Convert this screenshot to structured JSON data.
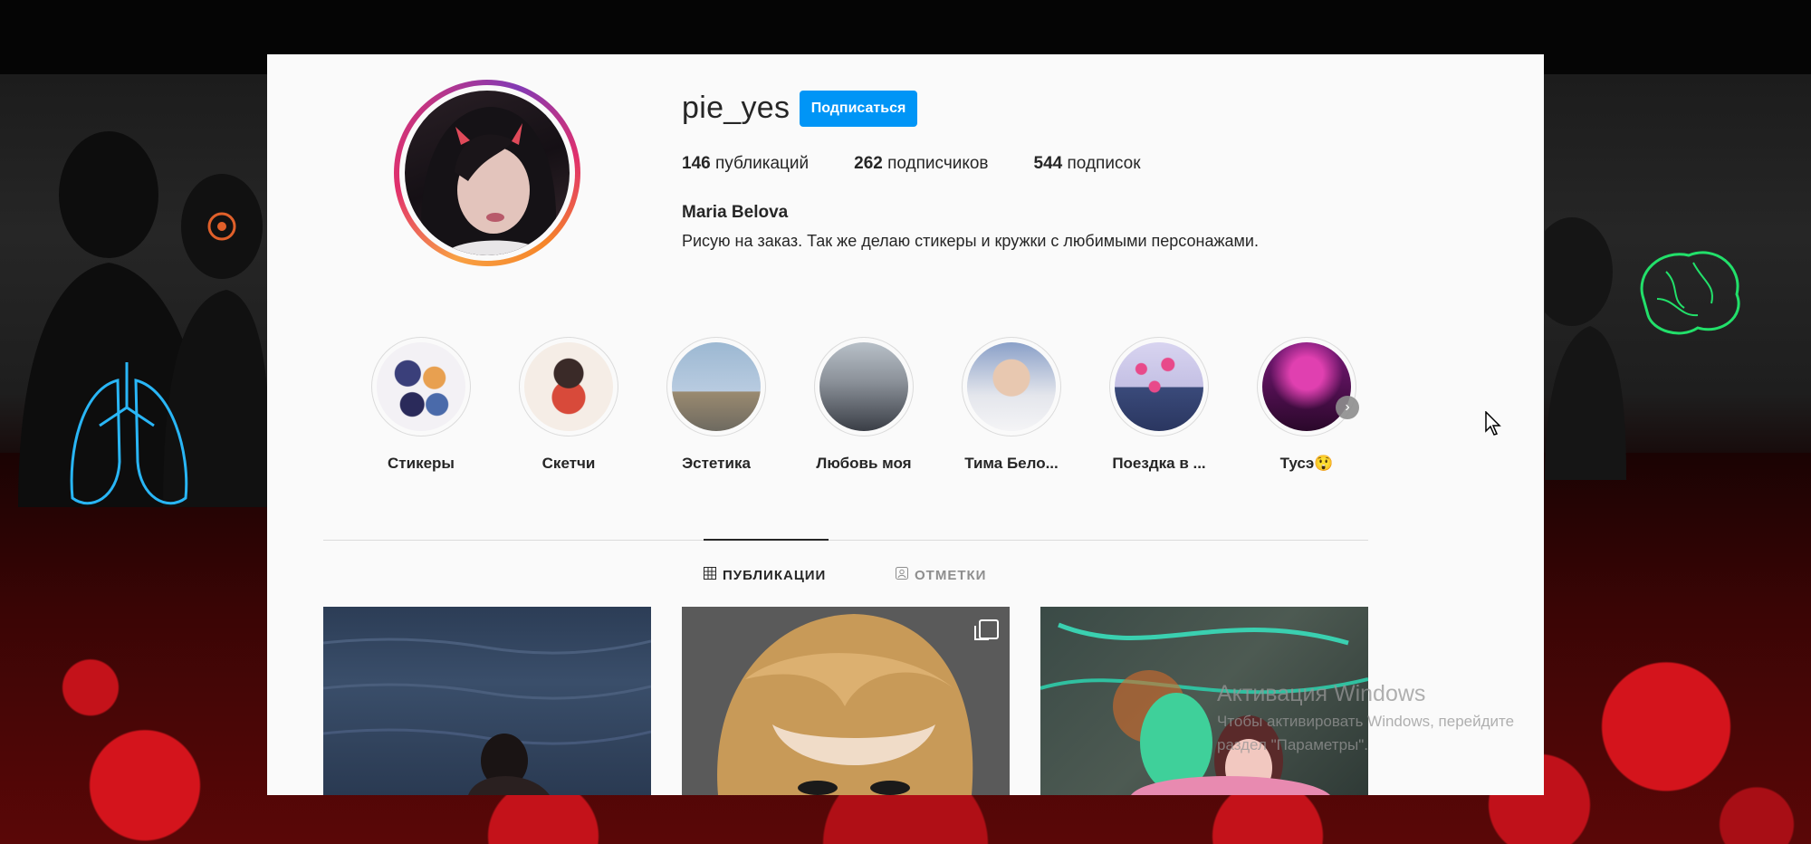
{
  "profile": {
    "username": "pie_yes",
    "follow_label": "Подписаться",
    "full_name": "Maria Belova",
    "bio": "Рисую на заказ. Так же делаю стикеры и кружки с любимыми персонажами.",
    "stats": {
      "posts_count": "146",
      "posts_label": "публикаций",
      "followers_count": "262",
      "followers_label": "подписчиков",
      "following_count": "544",
      "following_label": "подписок"
    }
  },
  "highlights": [
    {
      "label": "Стикеры",
      "color": "#e8e4ec"
    },
    {
      "label": "Скетчи",
      "color": "#f0e8e2"
    },
    {
      "label": "Эстетика",
      "color": "#9fb5cc"
    },
    {
      "label": "Любовь моя",
      "color": "#6e747c"
    },
    {
      "label": "Тима Бело...",
      "color": "#d8dde6"
    },
    {
      "label": "Поездка в ...",
      "color": "#c9c6e6"
    },
    {
      "label": "Тусэ😲",
      "color": "#9a1e7a"
    }
  ],
  "tabs": {
    "posts": "ПУБЛИКАЦИИ",
    "tagged": "ОТМЕТКИ"
  },
  "watermark": {
    "title": "Активация Windows",
    "line1": "Чтобы активировать Windows, перейдите",
    "line2": "раздел \"Параметры\"."
  },
  "icons": {
    "next": "chevron-right-icon",
    "grid": "grid-icon",
    "tag": "tag-person-icon",
    "multi": "carousel-icon"
  }
}
